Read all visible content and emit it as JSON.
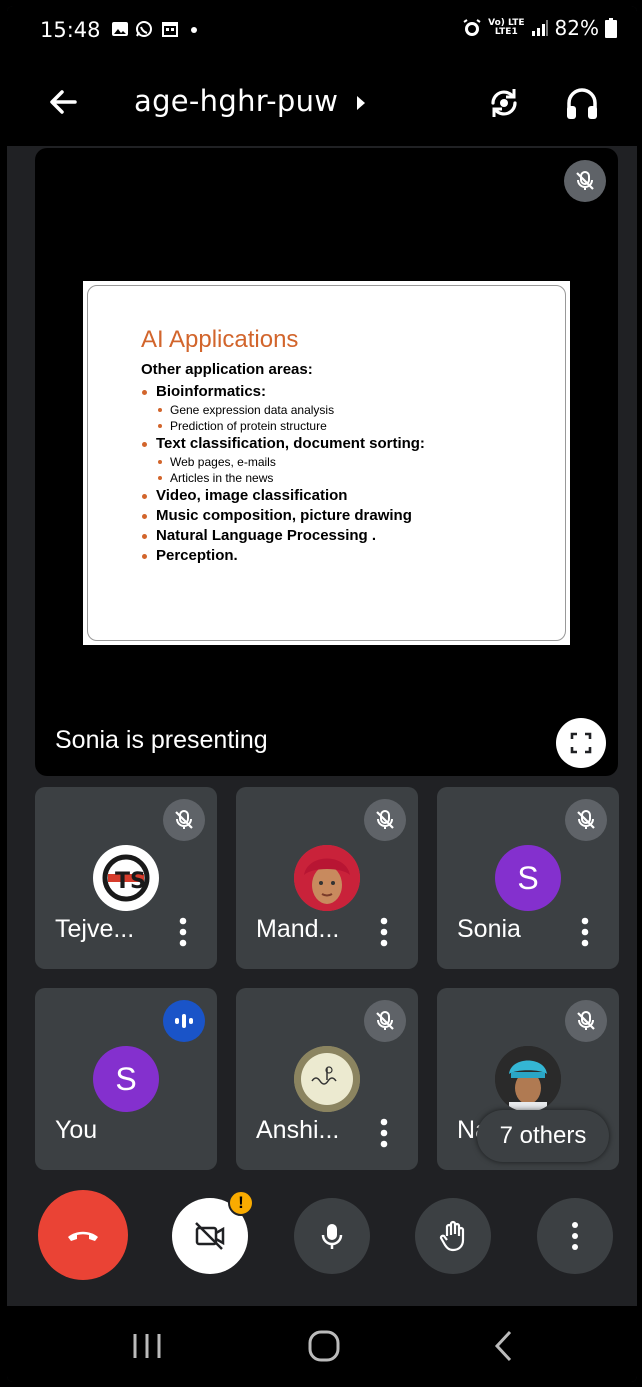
{
  "status_bar": {
    "time": "15:48",
    "battery": "82%",
    "network_top": "Vo) LTE",
    "network_bottom": "LTE1",
    "icons": [
      "gallery-icon",
      "whatsapp-icon",
      "calendar-icon",
      "alarm-icon",
      "signal-icon",
      "battery-icon"
    ]
  },
  "header": {
    "meeting_code": "age-hghr-puw",
    "icons": [
      "back-arrow-icon",
      "caret-right-icon",
      "switch-camera-icon",
      "headphones-icon"
    ]
  },
  "presentation": {
    "presenting_label": "Sonia is presenting",
    "slide": {
      "title": "AI Applications",
      "intro": "Other application areas:",
      "items": [
        {
          "text": "Bioinformatics:",
          "subitems": [
            "Gene expression data analysis",
            "Prediction of protein structure"
          ]
        },
        {
          "text": "Text classification, document sorting:",
          "subitems": [
            "Web pages, e-mails",
            "Articles in the news"
          ]
        },
        {
          "text": "Video, image classification",
          "subitems": []
        },
        {
          "text": "Music composition, picture drawing",
          "subitems": []
        },
        {
          "text": "Natural Language Processing .",
          "subitems": []
        },
        {
          "text": "Perception.",
          "subitems": []
        }
      ]
    }
  },
  "participants": [
    {
      "name": "Tejve...",
      "muted": true,
      "avatar": "logo"
    },
    {
      "name": "Mand...",
      "muted": true,
      "avatar": "photo"
    },
    {
      "name": "Sonia",
      "muted": true,
      "avatar_letter": "S"
    },
    {
      "name": "You",
      "muted": false,
      "speaking": true,
      "avatar_letter": "S"
    },
    {
      "name": "Anshi...",
      "muted": true,
      "avatar": "photo"
    },
    {
      "name": "Na",
      "muted": true,
      "avatar": "photo"
    }
  ],
  "others_chip": "7 others",
  "controls": [
    "end-call-button",
    "camera-off-button",
    "microphone-button",
    "raise-hand-button",
    "more-options-button"
  ],
  "colors": {
    "end_call": "#ea4335",
    "tile_bg": "#3c4043",
    "avatar_purple": "#8430ce",
    "speaking_blue": "#1a54c8",
    "warning_yellow": "#f9ab00",
    "slide_accent": "#d2652c"
  }
}
